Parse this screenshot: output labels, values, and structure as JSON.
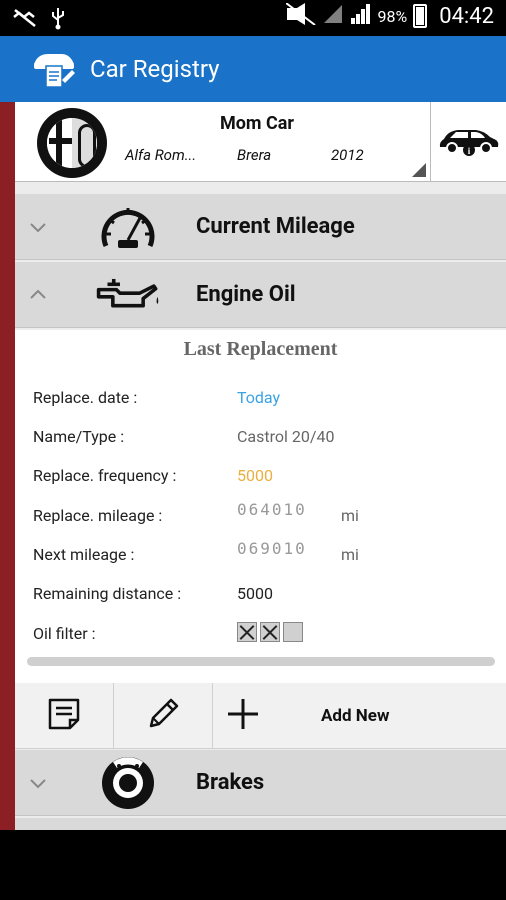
{
  "status_bar": {
    "battery": "98%",
    "time": "04:42"
  },
  "app_bar": {
    "title": "Car Registry"
  },
  "car": {
    "name": "Mom Car",
    "make": "Alfa Rom...",
    "model": "Brera",
    "year": "2012"
  },
  "sections": {
    "mileage": "Current Mileage",
    "engine_oil": "Engine Oil",
    "brakes": "Brakes"
  },
  "oil_panel": {
    "heading": "Last Replacement",
    "rows": [
      {
        "label": "Replace. date :",
        "value": "Today"
      },
      {
        "label": "Name/Type :",
        "value": "Castrol 20/40"
      },
      {
        "label": "Replace. frequency :",
        "value": "5000"
      },
      {
        "label": "Replace. mileage :",
        "value": "064010",
        "unit": "mi"
      },
      {
        "label": "Next mileage :",
        "value": "069010",
        "unit": "mi"
      },
      {
        "label": "Remaining distance :",
        "value": "5000"
      },
      {
        "label": "Oil filter :",
        "value": ""
      }
    ]
  },
  "toolbar": {
    "add_new": "Add New"
  },
  "colors": {
    "app_bar": "#1a73c9",
    "accent_strip": "#8b1f24",
    "link": "#3aa3e3",
    "highlight": "#e8b040"
  },
  "icons": [
    "usb-icon",
    "mute-icon",
    "wifi-icon",
    "signal-icon",
    "battery-icon",
    "registry-logo-icon",
    "alfa-romeo-badge-icon",
    "car-info-icon",
    "chevron-down-icon",
    "speedometer-icon",
    "chevron-up-icon",
    "oil-can-icon",
    "notes-icon",
    "pencil-icon",
    "plus-icon",
    "brake-disc-icon"
  ]
}
